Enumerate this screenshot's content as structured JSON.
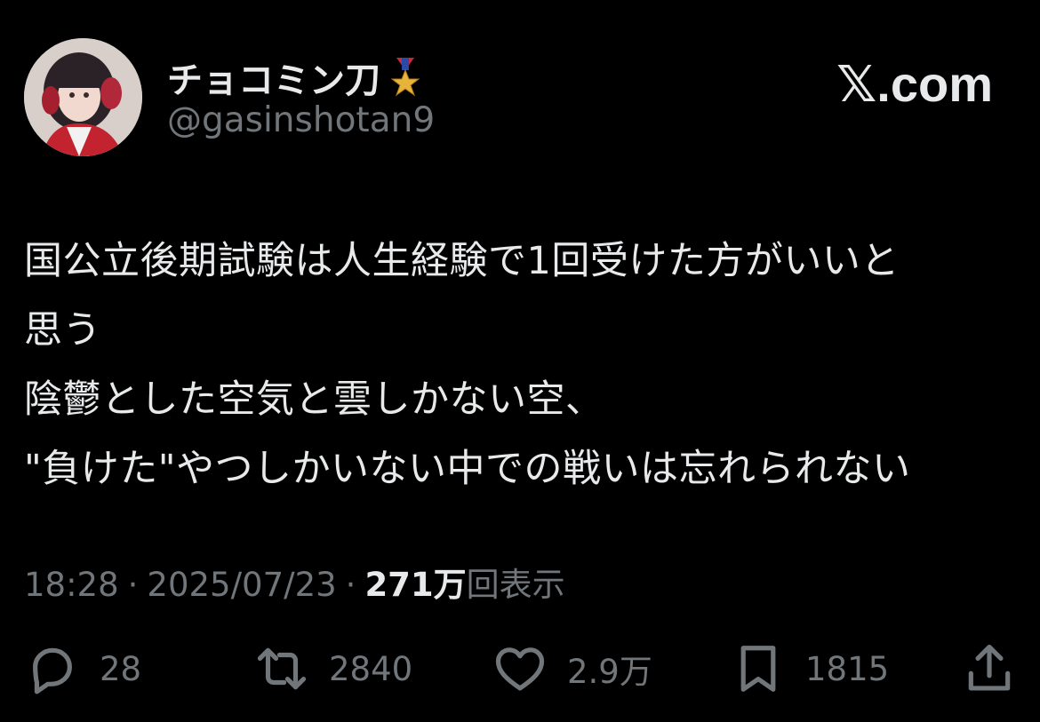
{
  "author": {
    "display_name": "チョコミン刀",
    "badge_icon": "medal-icon",
    "handle": "@gasinshotan9"
  },
  "brand": "𝕏.com",
  "post": {
    "lines": [
      "国公立後期試験は人生経験で1回受けた方がいいと",
      "思う",
      "陰鬱とした空気と雲しかない空、",
      "\"負けた\"やつしかいない中での戦いは忘れられない"
    ]
  },
  "meta": {
    "time": "18:28",
    "separator": "·",
    "date": "2025/07/23",
    "views_count": "271万",
    "views_label": "回表示"
  },
  "actions": {
    "reply": {
      "icon": "reply-icon",
      "count": "28"
    },
    "repost": {
      "icon": "repost-icon",
      "count": "2840"
    },
    "like": {
      "icon": "heart-icon",
      "count": "2.9万"
    },
    "bookmark": {
      "icon": "bookmark-icon",
      "count": "1815"
    },
    "share": {
      "icon": "share-icon"
    }
  },
  "colors": {
    "background": "#000000",
    "primary_text": "#e7e9ea",
    "secondary_text": "#71767b"
  }
}
